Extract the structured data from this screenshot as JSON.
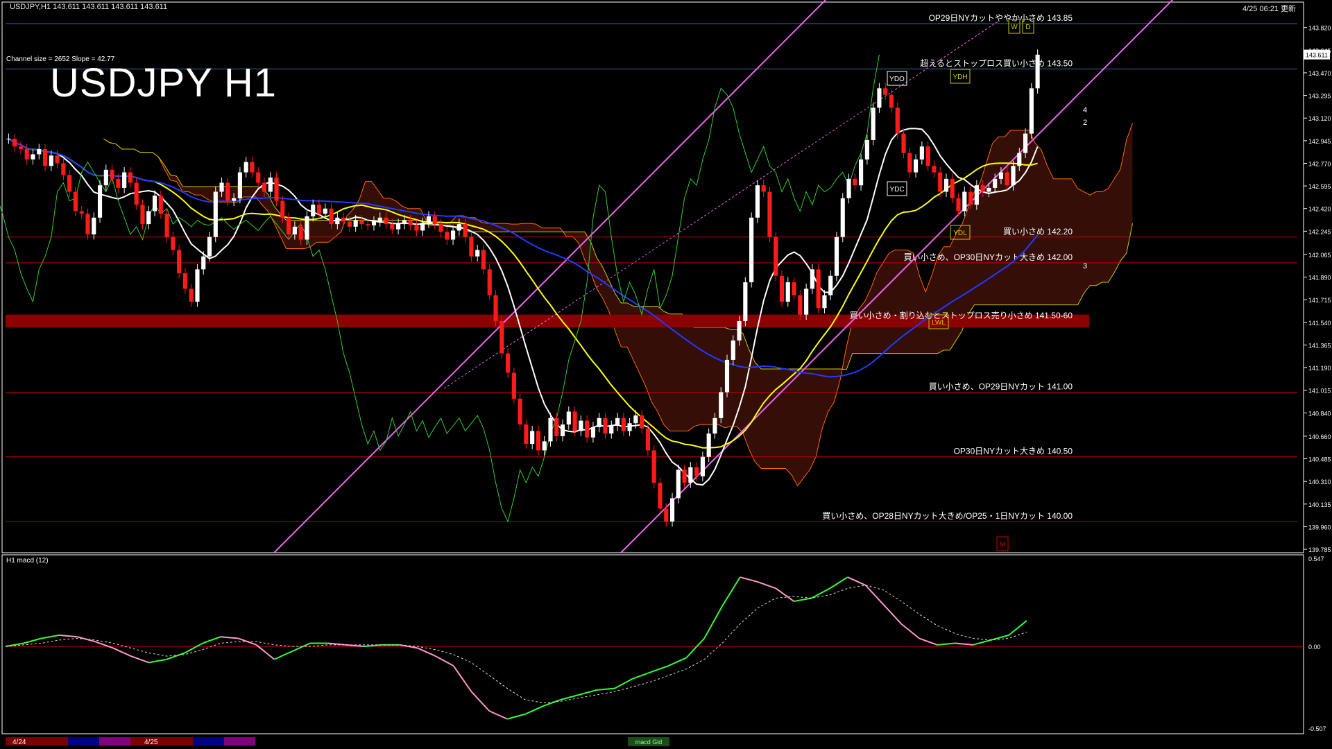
{
  "window": {
    "caption": "USDJPY,H1  143.611 143.611 143.611 143.611",
    "time": "4/25 06:21 更新",
    "channel_info": "Channel size = 2652  Slope = 42.77",
    "title": "USDJPY H1",
    "macd_caption": "H1  macd (12)"
  },
  "colors": {
    "background": "#000000",
    "bull_candle": "#ffffff",
    "bear_candle": "#ff1a1a",
    "price_axis_text": "#ffffff",
    "level_line": "#cc0000",
    "blue_level": "#3a6ea5",
    "yellow_ma": "#ffff00",
    "white_ma": "#ffffff",
    "blue_ma": "#1f3cff",
    "channel": "#ee66ee",
    "chikou": "#33cc33",
    "cloud_line": "#cccc00",
    "macd_up": "#33ff33",
    "macd_down": "#ff99cc",
    "signal": "#dddddd"
  },
  "chart_data": [
    {
      "type": "candlestick",
      "title": "USDJPY H1",
      "ylim": [
        139.78,
        143.99
      ],
      "price_ticks": [
        "143.820",
        "143.645",
        "143.470",
        "143.295",
        "143.120",
        "142.945",
        "142.770",
        "142.595",
        "142.420",
        "142.245",
        "142.065",
        "141.890",
        "141.715",
        "141.540",
        "141.365",
        "141.190",
        "141.015",
        "140.840",
        "140.660",
        "140.485",
        "140.310",
        "140.135",
        "139.960",
        "139.785"
      ],
      "current_price": "143.611",
      "level_annotations": [
        {
          "label": "OP29日NYカットややか小さめ 143.85",
          "price": 143.85,
          "color": "#3a6ea5"
        },
        {
          "label": "超えるとストップロス買い小さめ 143.50",
          "price": 143.5,
          "color": "#3a6ea5"
        },
        {
          "label": "買い小さめ 142.20",
          "price": 142.2,
          "color": "#cc0000"
        },
        {
          "label": "買い小さめ、OP30日NYカット大きめ 142.00",
          "price": 142.0,
          "color": "#cc0000"
        },
        {
          "label": "買い小さめ・割り込むとストップロス売り小さめ 141.50-60",
          "price": 141.55,
          "color": "#8b0000"
        },
        {
          "label": "買い小さめ、OP29日NYカット 141.00",
          "price": 141.0,
          "color": "#cc0000"
        },
        {
          "label": "OP30日NYカット大きめ 140.50",
          "price": 140.5,
          "color": "#cc0000"
        },
        {
          "label": "買い小さめ、OP28日NYカット大きめ/OP25・1日NYカット 140.00",
          "price": 140.0,
          "color": "#cc0000"
        }
      ],
      "box_labels": [
        "YDO",
        "YDC",
        "YDH",
        "YDL",
        "LWL",
        "W",
        "D",
        "M"
      ],
      "wave_labels": [
        "4",
        "2",
        "3"
      ],
      "close_series": [
        142.96,
        142.9,
        142.88,
        142.8,
        142.84,
        142.88,
        142.75,
        142.83,
        142.77,
        142.68,
        142.55,
        142.4,
        142.38,
        142.22,
        142.35,
        142.6,
        142.72,
        142.65,
        142.58,
        142.7,
        142.62,
        142.45,
        142.3,
        142.4,
        142.52,
        142.38,
        142.2,
        142.1,
        141.92,
        141.8,
        141.7,
        141.95,
        142.05,
        142.2,
        142.55,
        142.62,
        142.48,
        142.5,
        142.7,
        142.78,
        142.7,
        142.62,
        142.55,
        142.66,
        142.48,
        142.35,
        142.22,
        142.28,
        142.18,
        142.36,
        142.45,
        142.38,
        142.42,
        142.3,
        142.35,
        142.32,
        142.28,
        142.33,
        142.3,
        142.29,
        142.32,
        142.35,
        142.3,
        142.26,
        142.3,
        142.33,
        142.29,
        142.25,
        142.31,
        142.36,
        142.3,
        142.24,
        142.18,
        142.25,
        142.3,
        142.2,
        142.05,
        142.1,
        141.95,
        141.75,
        141.55,
        141.3,
        141.15,
        140.95,
        140.75,
        140.6,
        140.7,
        140.55,
        140.62,
        140.8,
        140.66,
        140.75,
        140.85,
        140.7,
        140.78,
        140.65,
        140.73,
        140.8,
        140.68,
        140.74,
        140.8,
        140.7,
        140.76,
        140.82,
        140.72,
        140.55,
        140.3,
        140.1,
        140.0,
        140.18,
        140.4,
        140.3,
        140.42,
        140.35,
        140.5,
        140.68,
        140.8,
        141.0,
        141.25,
        141.4,
        141.55,
        141.85,
        142.35,
        142.6,
        142.55,
        142.2,
        141.9,
        141.7,
        141.85,
        141.75,
        141.6,
        141.8,
        141.95,
        141.65,
        141.75,
        141.9,
        142.2,
        142.5,
        142.65,
        142.6,
        142.8,
        142.95,
        143.2,
        143.35,
        143.3,
        143.2,
        143.0,
        142.85,
        142.7,
        142.8,
        142.9,
        142.75,
        142.7,
        142.55,
        142.65,
        142.5,
        142.4,
        142.55,
        142.45,
        142.6,
        142.55,
        142.58,
        142.65,
        142.7,
        142.6,
        142.75,
        142.85,
        143.0,
        143.35,
        143.61
      ]
    },
    {
      "type": "line",
      "title": "macd (12)",
      "ylim": [
        -0.507,
        0.547
      ],
      "axis_ticks": [
        "0.547",
        "0.00",
        "-0.507"
      ],
      "series": [
        {
          "name": "macd",
          "values": [
            0.0,
            0.02,
            0.05,
            0.07,
            0.06,
            0.03,
            -0.01,
            -0.06,
            -0.1,
            -0.08,
            -0.04,
            0.02,
            0.06,
            0.05,
            0.01,
            -0.08,
            -0.03,
            0.02,
            0.02,
            0.01,
            0.0,
            0.01,
            0.01,
            -0.01,
            -0.06,
            -0.12,
            -0.28,
            -0.4,
            -0.45,
            -0.42,
            -0.37,
            -0.33,
            -0.3,
            -0.27,
            -0.26,
            -0.2,
            -0.16,
            -0.12,
            -0.07,
            0.05,
            0.25,
            0.43,
            0.4,
            0.36,
            0.28,
            0.3,
            0.36,
            0.43,
            0.38,
            0.26,
            0.14,
            0.05,
            0.01,
            0.02,
            0.01,
            0.04,
            0.07,
            0.16
          ]
        },
        {
          "name": "signal",
          "values": [
            0.0,
            0.01,
            0.02,
            0.04,
            0.05,
            0.04,
            0.02,
            -0.01,
            -0.04,
            -0.06,
            -0.05,
            -0.02,
            0.02,
            0.03,
            0.03,
            0.01,
            0.0,
            0.0,
            0.01,
            0.01,
            0.01,
            0.01,
            0.01,
            0.0,
            -0.02,
            -0.05,
            -0.1,
            -0.18,
            -0.26,
            -0.33,
            -0.35,
            -0.34,
            -0.32,
            -0.3,
            -0.28,
            -0.25,
            -0.22,
            -0.18,
            -0.14,
            -0.08,
            0.02,
            0.14,
            0.24,
            0.3,
            0.31,
            0.3,
            0.32,
            0.36,
            0.38,
            0.35,
            0.28,
            0.2,
            0.13,
            0.08,
            0.05,
            0.04,
            0.05,
            0.09
          ]
        }
      ]
    }
  ],
  "date_strip": [
    "4/24",
    "4/25"
  ],
  "footer_tag": "macd Gld"
}
